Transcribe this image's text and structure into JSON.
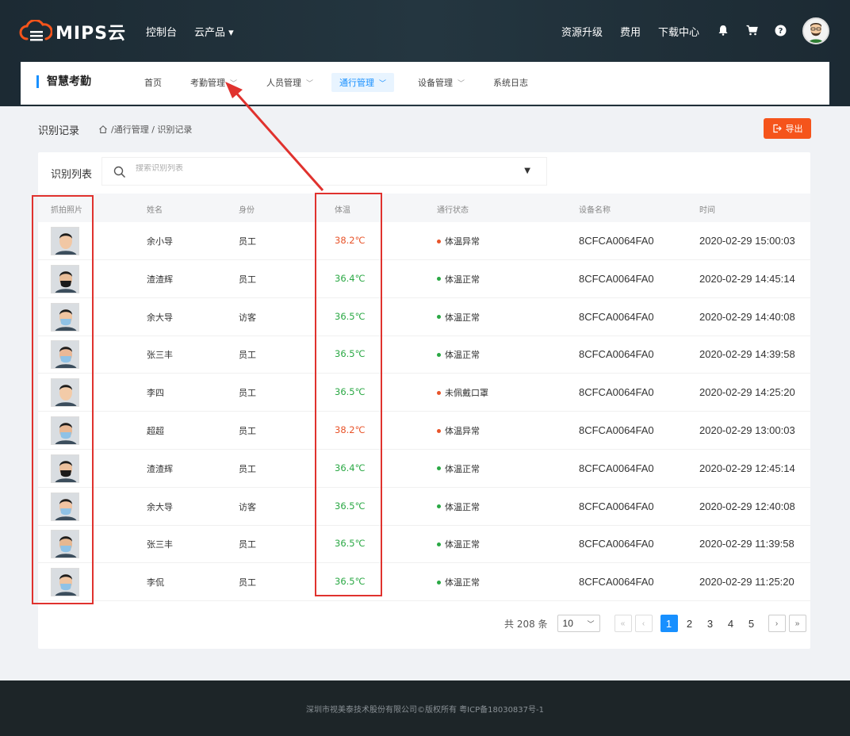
{
  "brand": {
    "logo_text": "MIPS云"
  },
  "topnav": {
    "left": [
      "控制台",
      "云产品 ▾"
    ],
    "right": [
      "资源升级",
      "费用",
      "下载中心"
    ],
    "icons": [
      "bell-icon",
      "cart-icon",
      "help-icon"
    ]
  },
  "subnav": {
    "title": "智慧考勤",
    "items": [
      {
        "label": "首页"
      },
      {
        "label": "考勤管理"
      },
      {
        "label": "人员管理"
      },
      {
        "label": "通行管理"
      },
      {
        "label": "设备管理"
      },
      {
        "label": "系统日志"
      }
    ]
  },
  "page": {
    "title": "识别记录",
    "breadcrumb": "/通行管理 / 识别记录",
    "export_label": "导出"
  },
  "list": {
    "label": "识别列表",
    "search_placeholder": "搜索识别列表"
  },
  "table": {
    "headers": [
      "抓拍照片",
      "姓名",
      "身份",
      "体温",
      "通行状态",
      "设备名称",
      "时间"
    ],
    "rows": [
      {
        "name": "余小导",
        "role": "员工",
        "temp": "38.2℃",
        "status": "体温异常",
        "device": "8CFCA0064FA0",
        "time": "2020-02-29 15:00:03",
        "abnormal": true
      },
      {
        "name": "渣渣辉",
        "role": "员工",
        "temp": "36.4℃",
        "status": "体温正常",
        "device": "8CFCA0064FA0",
        "time": "2020-02-29 14:45:14",
        "abnormal": false
      },
      {
        "name": "余大导",
        "role": "访客",
        "temp": "36.5℃",
        "status": "体温正常",
        "device": "8CFCA0064FA0",
        "time": "2020-02-29 14:40:08",
        "abnormal": false
      },
      {
        "name": "张三丰",
        "role": "员工",
        "temp": "36.5℃",
        "status": "体温正常",
        "device": "8CFCA0064FA0",
        "time": "2020-02-29 14:39:58",
        "abnormal": false
      },
      {
        "name": "李四",
        "role": "员工",
        "temp": "36.5℃",
        "status": "未佩戴口罩",
        "device": "8CFCA0064FA0",
        "time": "2020-02-29 14:25:20",
        "abnormal": true
      },
      {
        "name": "超超",
        "role": "员工",
        "temp": "38.2℃",
        "status": "体温异常",
        "device": "8CFCA0064FA0",
        "time": "2020-02-29 13:00:03",
        "abnormal": true
      },
      {
        "name": "渣渣辉",
        "role": "员工",
        "temp": "36.4℃",
        "status": "体温正常",
        "device": "8CFCA0064FA0",
        "time": "2020-02-29 12:45:14",
        "abnormal": false
      },
      {
        "name": "余大导",
        "role": "访客",
        "temp": "36.5℃",
        "status": "体温正常",
        "device": "8CFCA0064FA0",
        "time": "2020-02-29 12:40:08",
        "abnormal": false
      },
      {
        "name": "张三丰",
        "role": "员工",
        "temp": "36.5℃",
        "status": "体温正常",
        "device": "8CFCA0064FA0",
        "time": "2020-02-29 11:39:58",
        "abnormal": false
      },
      {
        "name": "李侃",
        "role": "员工",
        "temp": "36.5℃",
        "status": "体温正常",
        "device": "8CFCA0064FA0",
        "time": "2020-02-29 11:25:20",
        "abnormal": false
      }
    ]
  },
  "pagination": {
    "total": "共 208 条",
    "page_size": "10",
    "pages": [
      "1",
      "2",
      "3",
      "4",
      "5"
    ],
    "current": "1"
  },
  "footer": {
    "text": "深圳市视美泰技术股份有限公司©版权所有 粤ICP备18030837号-1"
  },
  "colors": {
    "accent": "#1890ff",
    "export": "#f5541b",
    "abnormal": "#e8542a",
    "normal": "#2aa844",
    "highlight": "#e0322e"
  }
}
